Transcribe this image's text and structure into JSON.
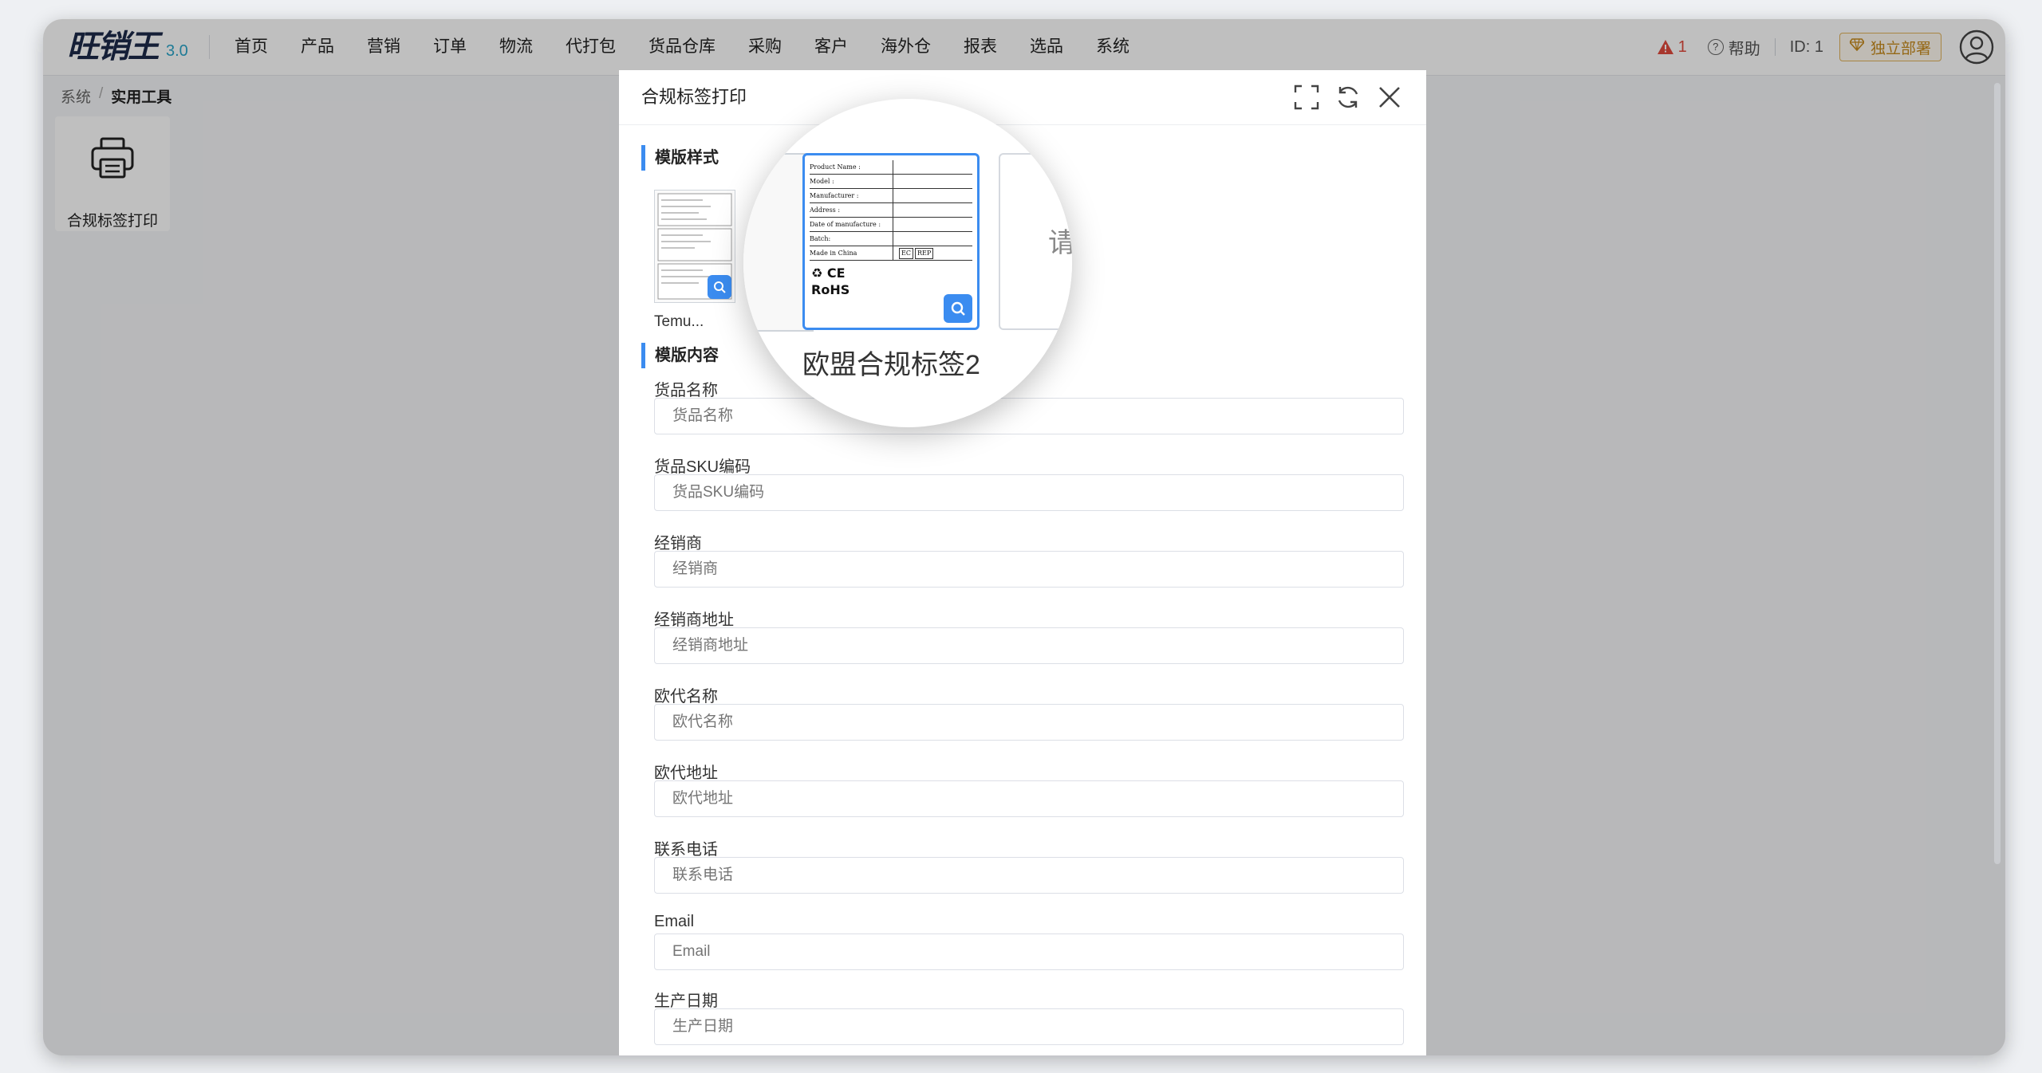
{
  "app": {
    "logo_text": "旺销王",
    "version": "3.0",
    "nav": [
      "首页",
      "产品",
      "营销",
      "订单",
      "物流",
      "代打包",
      "货品仓库",
      "采购",
      "客户",
      "海外仓",
      "报表",
      "选品",
      "系统"
    ],
    "alert_count": "1",
    "help_label": "帮助",
    "user_id": "ID: 1",
    "deploy_label": "独立部署"
  },
  "breadcrumb": {
    "parent": "系统",
    "separator": "/",
    "current": "实用工具"
  },
  "tool_card": {
    "label": "合规标签打印"
  },
  "modal": {
    "title": "合规标签打印",
    "template_style_heading": "模版样式",
    "template_content_heading": "模版内容",
    "templates": [
      {
        "label": "Temu..."
      },
      {
        "label": "欧盟合规标签2"
      },
      {
        "label": "请..."
      }
    ],
    "label_preview": {
      "lines": [
        "Product Name :",
        "Model :",
        "Manufacturer :",
        "Address :",
        "Date of manufacture :",
        "Batch:",
        "Made in China"
      ],
      "marks": [
        "EC",
        "REP",
        "RoHS"
      ]
    },
    "fields": [
      {
        "label": "货品名称",
        "placeholder": "货品名称"
      },
      {
        "label": "货品SKU编码",
        "placeholder": "货品SKU编码"
      },
      {
        "label": "经销商",
        "placeholder": "经销商"
      },
      {
        "label": "经销商地址",
        "placeholder": "经销商地址"
      },
      {
        "label": "欧代名称",
        "placeholder": "欧代名称"
      },
      {
        "label": "欧代地址",
        "placeholder": "欧代地址"
      },
      {
        "label": "联系电话",
        "placeholder": "联系电话"
      },
      {
        "label": "Email",
        "placeholder": "Email"
      },
      {
        "label": "生产日期",
        "placeholder": "生产日期"
      }
    ]
  },
  "icons": [
    "warning-icon",
    "help-icon",
    "gem-icon",
    "user-avatar-icon",
    "printer-icon",
    "fullscreen-icon",
    "refresh-icon",
    "close-icon",
    "search-icon"
  ],
  "colors": {
    "accent": "#3b8cf0",
    "alert": "#e04a3c",
    "deploy": "#c78b1e",
    "logo_version": "#2aa5c9"
  }
}
